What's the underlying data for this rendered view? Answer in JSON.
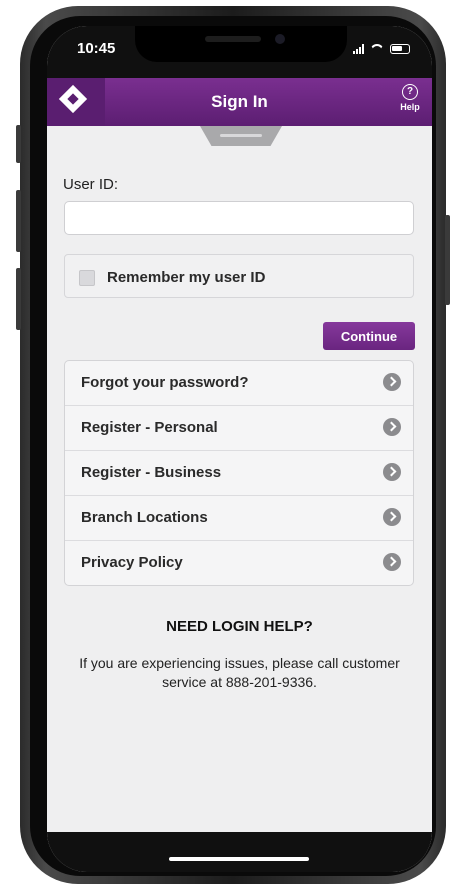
{
  "status": {
    "time": "10:45"
  },
  "header": {
    "title": "Sign In",
    "help_label": "Help",
    "help_glyph": "?"
  },
  "form": {
    "userid_label": "User ID:",
    "userid_value": "",
    "remember_label": "Remember my user ID",
    "remember_checked": false,
    "continue_label": "Continue"
  },
  "menu": {
    "items": [
      {
        "label": "Forgot your password?"
      },
      {
        "label": "Register - Personal"
      },
      {
        "label": "Register - Business"
      },
      {
        "label": "Branch Locations"
      },
      {
        "label": "Privacy Policy"
      }
    ]
  },
  "help": {
    "heading": "NEED LOGIN HELP?",
    "text": "If you are experiencing issues, please call customer service at 888-201-9336."
  },
  "colors": {
    "brand": "#6a2580",
    "background": "#efeff0"
  },
  "icons": {
    "logo": "diamond-logo-icon",
    "help": "question-circle-icon",
    "chevron": "chevron-right-circle-icon"
  }
}
